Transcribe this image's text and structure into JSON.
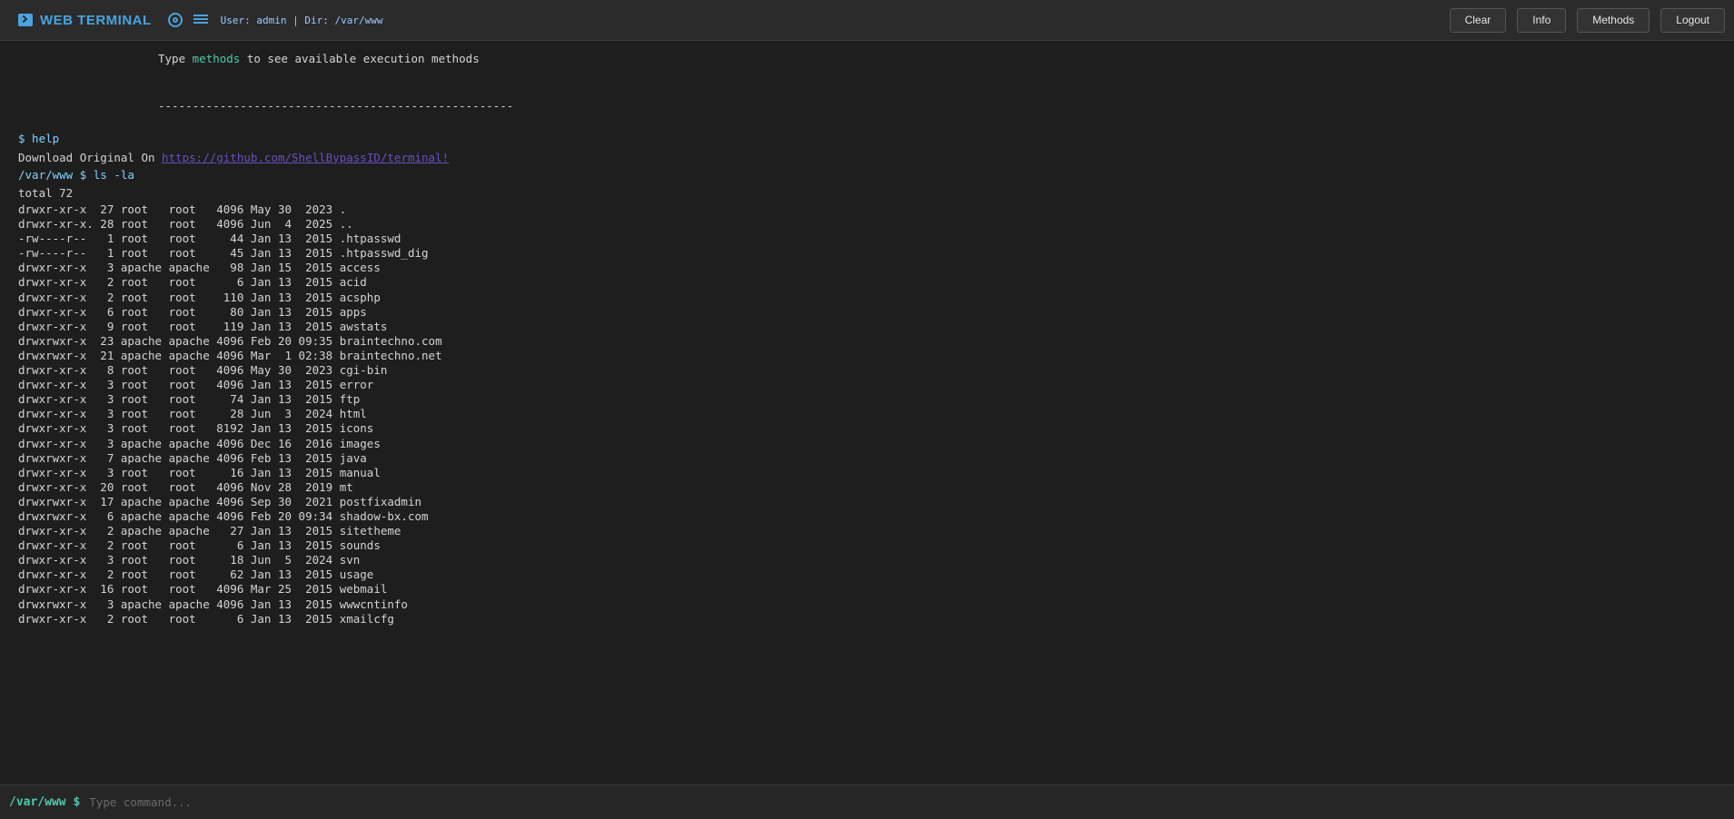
{
  "header": {
    "title": "WEB TERMINAL",
    "user_info": "User: admin | Dir: /var/www",
    "buttons": {
      "clear": "Clear",
      "info": "Info",
      "methods": "Methods",
      "logout": "Logout"
    },
    "icons": {
      "logo": "terminal-icon",
      "settings": "gear-icon",
      "list": "list-icon"
    },
    "accent_color": "#4aa3df"
  },
  "output": {
    "methods_hint": {
      "before": "Type ",
      "keyword": "methods",
      "after": " to see available execution methods"
    },
    "separator": "----------------------------------------------------",
    "help_command": "$ help",
    "download_label": "Download Original On ",
    "download_link": "https://github.com/ShellBypassID/terminal!",
    "ls_command": "/var/www $ ls -la",
    "listing": [
      "total 72",
      "drwxr-xr-x  27 root   root   4096 May 30  2023 .",
      "drwxr-xr-x. 28 root   root   4096 Jun  4  2025 ..",
      "-rw----r--   1 root   root     44 Jan 13  2015 .htpasswd",
      "-rw----r--   1 root   root     45 Jan 13  2015 .htpasswd_dig",
      "drwxr-xr-x   3 apache apache   98 Jan 15  2015 access",
      "drwxr-xr-x   2 root   root      6 Jan 13  2015 acid",
      "drwxr-xr-x   2 root   root    110 Jan 13  2015 acsphp",
      "drwxr-xr-x   6 root   root     80 Jan 13  2015 apps",
      "drwxr-xr-x   9 root   root    119 Jan 13  2015 awstats",
      "drwxrwxr-x  23 apache apache 4096 Feb 20 09:35 braintechno.com",
      "drwxrwxr-x  21 apache apache 4096 Mar  1 02:38 braintechno.net",
      "drwxr-xr-x   8 root   root   4096 May 30  2023 cgi-bin",
      "drwxr-xr-x   3 root   root   4096 Jan 13  2015 error",
      "drwxr-xr-x   3 root   root     74 Jan 13  2015 ftp",
      "drwxr-xr-x   3 root   root     28 Jun  3  2024 html",
      "drwxr-xr-x   3 root   root   8192 Jan 13  2015 icons",
      "drwxr-xr-x   3 apache apache 4096 Dec 16  2016 images",
      "drwxrwxr-x   7 apache apache 4096 Feb 13  2015 java",
      "drwxr-xr-x   3 root   root     16 Jan 13  2015 manual",
      "drwxr-xr-x  20 root   root   4096 Nov 28  2019 mt",
      "drwxrwxr-x  17 apache apache 4096 Sep 30  2021 postfixadmin",
      "drwxrwxr-x   6 apache apache 4096 Feb 20 09:34 shadow-bx.com",
      "drwxr-xr-x   2 apache apache   27 Jan 13  2015 sitetheme",
      "drwxr-xr-x   2 root   root      6 Jan 13  2015 sounds",
      "drwxr-xr-x   3 root   root     18 Jun  5  2024 svn",
      "drwxr-xr-x   2 root   root     62 Jan 13  2015 usage",
      "drwxr-xr-x  16 root   root   4096 Mar 25  2015 webmail",
      "drwxrwxr-x   3 apache apache 4096 Jan 13  2015 wwwcntinfo",
      "drwxr-xr-x   2 root   root      6 Jan 13  2015 xmailcfg"
    ]
  },
  "input": {
    "prompt": "/var/www $",
    "placeholder": "Type command...",
    "value": ""
  }
}
